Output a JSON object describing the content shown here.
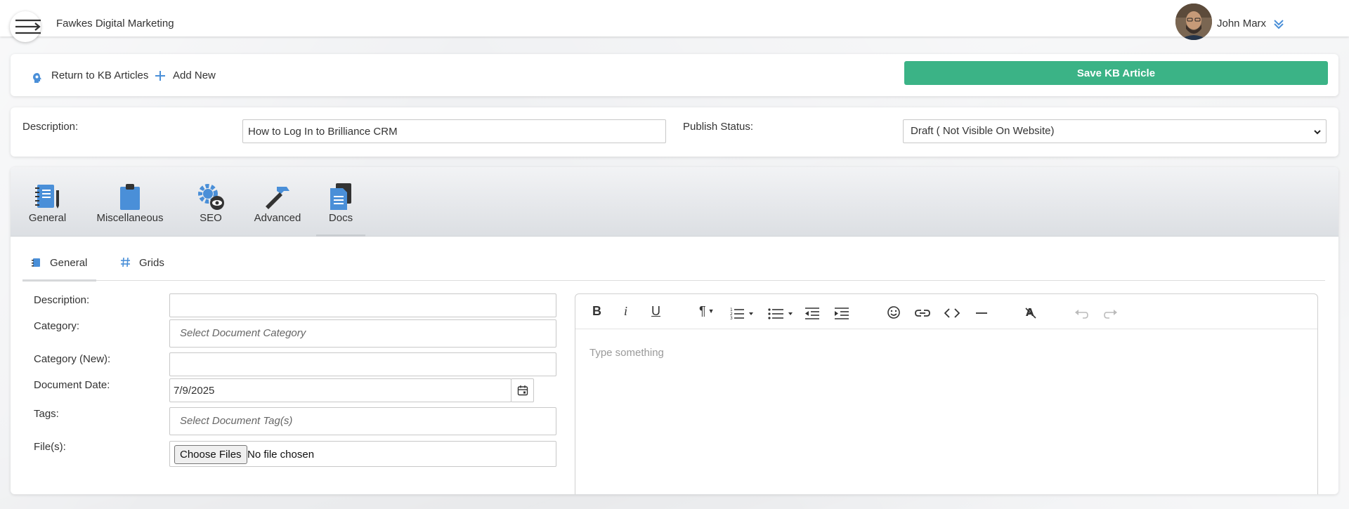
{
  "header": {
    "company": "Fawkes Digital Marketing",
    "user_name": "John Marx"
  },
  "actions": {
    "return_label": "Return to KB Articles",
    "add_new_label": "Add New",
    "save_label": "Save KB Article"
  },
  "article": {
    "description_label": "Description:",
    "description_value": "How to Log In to Brilliance CRM",
    "publish_status_label": "Publish Status:",
    "publish_status_value": "Draft ( Not Visible On Website)"
  },
  "main_tabs": [
    {
      "label": "General"
    },
    {
      "label": "Miscellaneous"
    },
    {
      "label": "SEO"
    },
    {
      "label": "Advanced"
    },
    {
      "label": "Docs"
    }
  ],
  "sub_tabs": [
    {
      "label": "General"
    },
    {
      "label": "Grids"
    }
  ],
  "doc_form": {
    "description_label": "Description:",
    "description_value": "",
    "category_label": "Category:",
    "category_placeholder": "Select Document Category",
    "category_new_label": "Category (New):",
    "category_new_value": "",
    "date_label": "Document Date:",
    "date_value": "7/9/2025",
    "tags_label": "Tags:",
    "tags_placeholder": "Select Document Tag(s)",
    "files_label": "File(s):",
    "choose_files_label": "Choose Files",
    "file_status": "No file chosen"
  },
  "editor": {
    "placeholder": "Type something"
  },
  "colors": {
    "accent_green": "#3bb386",
    "icon_blue": "#4a8fd8"
  }
}
